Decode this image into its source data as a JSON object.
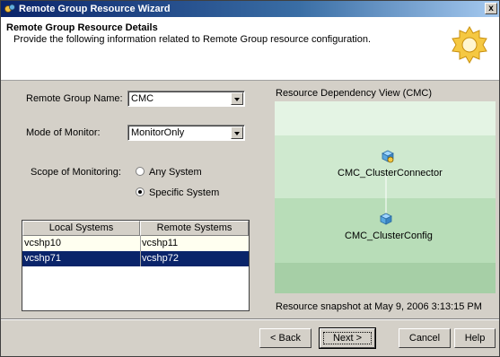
{
  "window": {
    "title": "Remote Group Resource Wizard",
    "close_glyph": "x",
    "app_icon": "wizard-app-icon"
  },
  "header": {
    "title": "Remote Group Resource Details",
    "description": "Provide the following information related to Remote Group resource configuration.",
    "icon": "gear-icon"
  },
  "form": {
    "remote_group_label": "Remote Group Name:",
    "remote_group_value": "CMC",
    "mode_label": "Mode of Monitor:",
    "mode_value": "MonitorOnly",
    "scope_label": "Scope of Monitoring:",
    "scope_options": [
      {
        "label": "Any System",
        "selected": false
      },
      {
        "label": "Specific System",
        "selected": true
      }
    ]
  },
  "systems_table": {
    "columns": [
      "Local Systems",
      "Remote Systems"
    ],
    "rows": [
      {
        "local": "vcshp10",
        "remote": "vcshp11",
        "selected": false
      },
      {
        "local": "vcshp71",
        "remote": "vcshp72",
        "selected": true
      }
    ]
  },
  "dependency_view": {
    "title": "Resource Dependency View (CMC)",
    "nodes": [
      {
        "label": "CMC_ClusterConnector",
        "icon": "resource-connector-icon"
      },
      {
        "label": "CMC_ClusterConfig",
        "icon": "resource-config-icon"
      }
    ],
    "snapshot": "Resource snapshot at May 9, 2006 3:13:15 PM"
  },
  "buttons": {
    "back": "< Back",
    "next": "Next >",
    "cancel": "Cancel",
    "help": "Help"
  },
  "colors": {
    "title_bar": "#0a246a",
    "selection": "#0a246a",
    "band_light": "#e4f4e4",
    "band_mid": "#cfe9cf",
    "band_dark": "#b8ddb8",
    "band_bottom": "#a6cfa6"
  }
}
